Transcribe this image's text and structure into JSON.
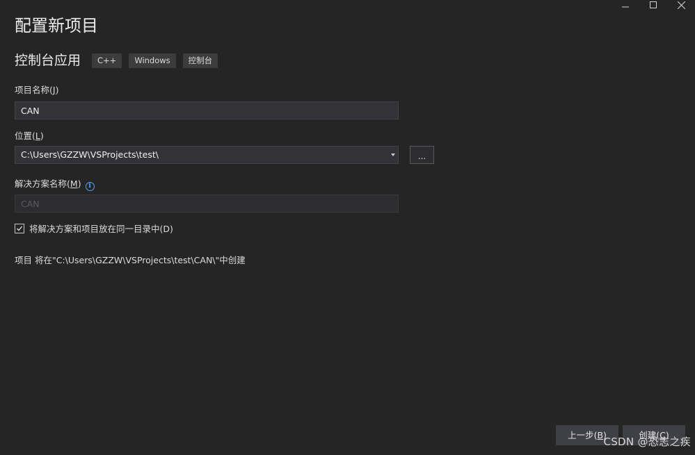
{
  "window": {
    "minimize_icon": "minimize-icon",
    "maximize_icon": "maximize-icon",
    "close_icon": "close-icon"
  },
  "header": {
    "title": "配置新项目",
    "template_name": "控制台应用",
    "tags": [
      "C++",
      "Windows",
      "控制台"
    ]
  },
  "form": {
    "project_name": {
      "label": "项目名称(",
      "accel": "J",
      "label_end": ")",
      "value": "CAN"
    },
    "location": {
      "label": "位置(",
      "accel": "L",
      "label_end": ")",
      "value": "C:\\Users\\GZZW\\VSProjects\\test\\",
      "browse_label": "..."
    },
    "solution_name": {
      "label": "解决方案名称(",
      "accel": "M",
      "label_end": ")",
      "placeholder": "CAN",
      "info_icon": "info-icon"
    },
    "same_dir": {
      "checked": true,
      "label": "将解决方案和项目放在同一目录中(",
      "accel": "D",
      "label_end": ")"
    },
    "note": "项目 将在\"C:\\Users\\GZZW\\VSProjects\\test\\CAN\\\"中创建"
  },
  "footer": {
    "back": {
      "label": "上一步(",
      "accel": "B",
      "label_end": ")"
    },
    "create": {
      "label": "创建(",
      "accel": "C",
      "label_end": ")"
    }
  },
  "watermark": "CSDN @恐志之疾"
}
